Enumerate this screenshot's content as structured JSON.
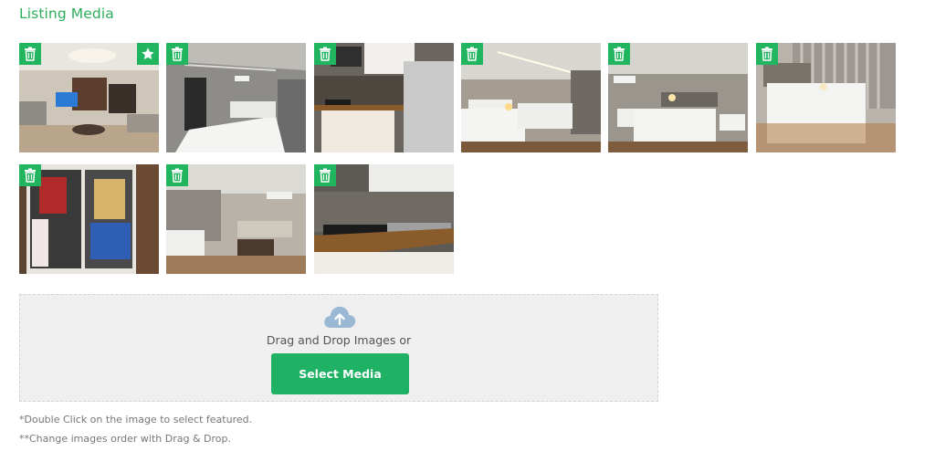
{
  "section": {
    "title": "Listing Media"
  },
  "thumbnails": [
    {
      "name": "living-room",
      "featured": true
    },
    {
      "name": "bedroom-dark",
      "featured": false
    },
    {
      "name": "kitchenette",
      "featured": false
    },
    {
      "name": "twin-bedroom",
      "featured": false
    },
    {
      "name": "bedroom-lamps",
      "featured": false
    },
    {
      "name": "single-bed",
      "featured": false
    },
    {
      "name": "snacks-drawer",
      "featured": false
    },
    {
      "name": "studio-overview",
      "featured": false
    },
    {
      "name": "kitchen-counter",
      "featured": false
    }
  ],
  "icons": {
    "delete": "trash-icon",
    "featured": "star-icon",
    "upload": "cloud-upload-icon"
  },
  "colors": {
    "accent": "#22b55f",
    "title": "#2eae5c",
    "upload_icon": "#9ab8d4"
  },
  "dropzone": {
    "instruction": "Drag and Drop Images or",
    "button_label": "Select Media"
  },
  "notes": {
    "featured_hint": "*Double Click on the image to select featured.",
    "order_hint": "**Change images order with Drag & Drop."
  }
}
